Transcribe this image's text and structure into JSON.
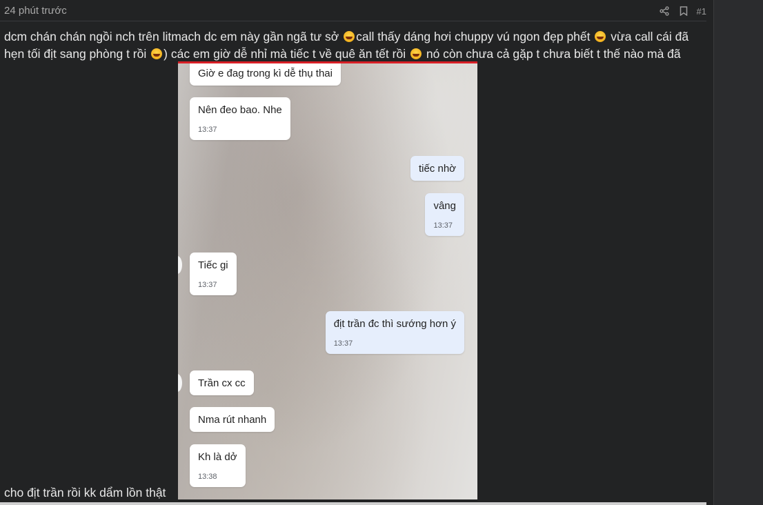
{
  "post": {
    "time": "24 phút trước",
    "number": "#1",
    "line1_a": "dcm chán chán ngồi nch trên litmach dc em này gần ngã tư sở",
    "line1_b": "call thấy dáng hơi chuppy vú ngon đẹp phết",
    "line1_c": " vừa call cái đã",
    "line2_a": "hẹn tối địt sang phòng t rồi",
    "line2_b": ") các em giờ dễ nhỉ mà tiếc t về quê ăn tết rồi",
    "line2_c": " nó còn chưa cả gặp t chưa biết t thế nào mà đã",
    "tail": "cho địt trần rồi kk dẩm lồn thật"
  },
  "icons": {
    "share": "share-icon",
    "bookmark": "bookmark-icon",
    "emoji": "laughing-face-emoji"
  },
  "chat": [
    {
      "dir": "in",
      "text": "Giờ e đag trong kì dễ thụ thai",
      "time": ""
    },
    {
      "dir": "in",
      "text": "Nên đeo bao. Nhe",
      "time": "13:37"
    },
    {
      "dir": "out",
      "text": "tiếc nhờ",
      "time": ""
    },
    {
      "dir": "out",
      "text": "vâng",
      "time": "13:37"
    },
    {
      "dir": "in",
      "text": "Tiếc gi",
      "time": "13:37"
    },
    {
      "dir": "out",
      "text": "địt trần đc thì sướng hơn ý",
      "time": "13:37"
    },
    {
      "dir": "in",
      "text": "Trần cx cc",
      "time": ""
    },
    {
      "dir": "in",
      "text": "Nma rút nhanh",
      "time": ""
    },
    {
      "dir": "in",
      "text": "Kh là dở",
      "time": "13:38"
    }
  ],
  "colors": {
    "page_bg": "#222324",
    "divider_red": "#d81f26",
    "bubble_in": "#ffffff",
    "bubble_out": "#e6eefc"
  }
}
